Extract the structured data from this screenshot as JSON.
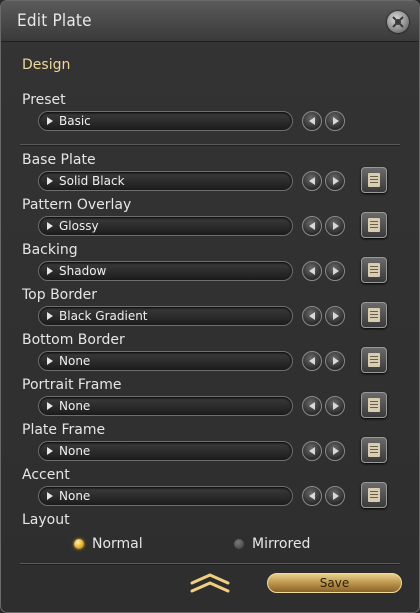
{
  "window": {
    "title": "Edit Plate"
  },
  "design": {
    "heading": "Design",
    "preset": {
      "label": "Preset",
      "value": "Basic"
    },
    "rows": [
      {
        "label": "Base Plate",
        "value": "Solid Black"
      },
      {
        "label": "Pattern Overlay",
        "value": "Glossy"
      },
      {
        "label": "Backing",
        "value": "Shadow"
      },
      {
        "label": "Top Border",
        "value": "Black Gradient"
      },
      {
        "label": "Bottom Border",
        "value": "None"
      },
      {
        "label": "Portrait Frame",
        "value": "None"
      },
      {
        "label": "Plate Frame",
        "value": "None"
      },
      {
        "label": "Accent",
        "value": "None"
      }
    ]
  },
  "layout": {
    "label": "Layout",
    "options": [
      {
        "label": "Normal",
        "selected": true
      },
      {
        "label": "Mirrored",
        "selected": false
      }
    ]
  },
  "footer": {
    "save_label": "Save"
  },
  "colors": {
    "heading": "#f0d79a",
    "save_button": "#c8a060",
    "selected_radio": "#e0a820"
  }
}
